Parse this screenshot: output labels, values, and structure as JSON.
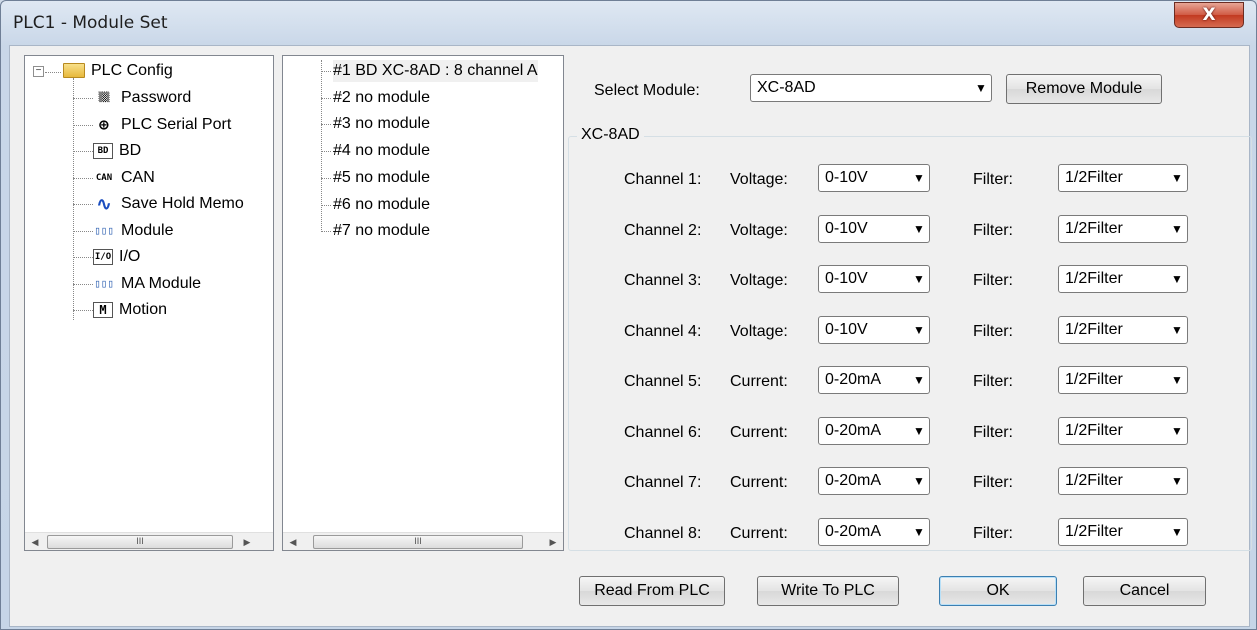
{
  "window": {
    "title": "PLC1 - Module  Set",
    "close_glyph": "X"
  },
  "tree": {
    "root_label": "PLC Config",
    "items": [
      {
        "label": "Password",
        "icon": "password-icon",
        "glyph": "▒▒"
      },
      {
        "label": "PLC Serial Port",
        "icon": "serial-port-icon",
        "glyph": "⊕"
      },
      {
        "label": "BD",
        "icon": "bd-icon",
        "glyph": "BD"
      },
      {
        "label": "CAN",
        "icon": "can-icon",
        "glyph": "CAN"
      },
      {
        "label": "Save Hold Memo",
        "icon": "waveform-icon",
        "glyph": "∿"
      },
      {
        "label": "Module",
        "icon": "module-icon",
        "glyph": "▯▯▯"
      },
      {
        "label": "I/O",
        "icon": "io-icon",
        "glyph": "I/O"
      },
      {
        "label": "MA Module",
        "icon": "ma-module-icon",
        "glyph": "▯▯▯"
      },
      {
        "label": "Motion",
        "icon": "motion-icon",
        "glyph": "M"
      }
    ]
  },
  "module_list": {
    "items": [
      "#1 BD XC-8AD : 8 channel A",
      "#2 no module",
      "#3 no module",
      "#4 no module",
      "#5 no module",
      "#6 no module",
      "#7 no module"
    ]
  },
  "select_module": {
    "label": "Select Module:",
    "value": "XC-8AD",
    "remove_button": "Remove Module"
  },
  "group": {
    "title": "XC-8AD",
    "filter_label": "Filter:",
    "channels": [
      {
        "name": "Channel 1:",
        "type": "Voltage:",
        "range": "0-10V",
        "filter": "1/2Filter"
      },
      {
        "name": "Channel 2:",
        "type": "Voltage:",
        "range": "0-10V",
        "filter": "1/2Filter"
      },
      {
        "name": "Channel 3:",
        "type": "Voltage:",
        "range": "0-10V",
        "filter": "1/2Filter"
      },
      {
        "name": "Channel 4:",
        "type": "Voltage:",
        "range": "0-10V",
        "filter": "1/2Filter"
      },
      {
        "name": "Channel 5:",
        "type": "Current:",
        "range": "0-20mA",
        "filter": "1/2Filter"
      },
      {
        "name": "Channel 6:",
        "type": "Current:",
        "range": "0-20mA",
        "filter": "1/2Filter"
      },
      {
        "name": "Channel 7:",
        "type": "Current:",
        "range": "0-20mA",
        "filter": "1/2Filter"
      },
      {
        "name": "Channel 8:",
        "type": "Current:",
        "range": "0-20mA",
        "filter": "1/2Filter"
      }
    ]
  },
  "buttons": {
    "read": "Read From PLC",
    "write": "Write To PLC",
    "ok": "OK",
    "cancel": "Cancel"
  },
  "scroll_thumb_glyph": "III"
}
